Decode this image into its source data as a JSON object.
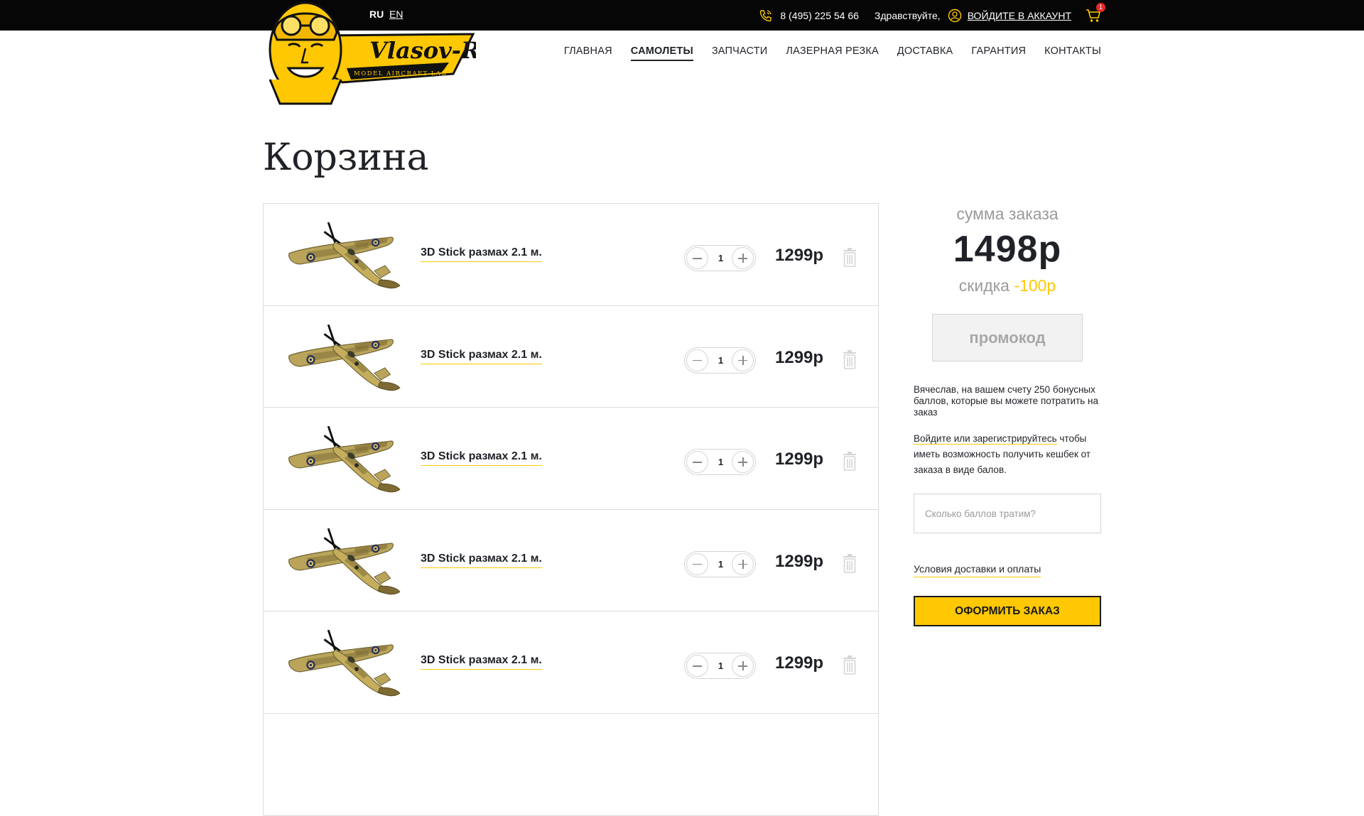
{
  "header": {
    "lang_ru": "RU",
    "lang_en": "EN",
    "phone": "8 (495) 225 54 66",
    "greeting": "Здравствуйте,",
    "login_label": "ВОЙДИТЕ В АККАУНТ",
    "cart_count": "1"
  },
  "logo": {
    "brand": "Vlasov-RC",
    "tagline": "MODEL AIRCRAFT LAB"
  },
  "nav": {
    "items": [
      {
        "label": "ГЛАВНАЯ"
      },
      {
        "label": "САМОЛЕТЫ"
      },
      {
        "label": "ЗАПЧАСТИ"
      },
      {
        "label": "ЛАЗЕРНАЯ РЕЗКА"
      },
      {
        "label": "ДОСТАВКА"
      },
      {
        "label": "ГАРАНТИЯ"
      },
      {
        "label": "КОНТАКТЫ"
      }
    ],
    "active": "САМОЛЕТЫ"
  },
  "page": {
    "title": "Корзина"
  },
  "cart": {
    "items": [
      {
        "name": "3D Stick размах 2.1 м.",
        "qty": "1",
        "price": "1299р"
      },
      {
        "name": "3D Stick размах 2.1 м.",
        "qty": "1",
        "price": "1299р"
      },
      {
        "name": "3D Stick размах 2.1 м.",
        "qty": "1",
        "price": "1299р"
      },
      {
        "name": "3D Stick размах 2.1 м.",
        "qty": "1",
        "price": "1299р"
      },
      {
        "name": "3D Stick размах 2.1 м.",
        "qty": "1",
        "price": "1299р"
      }
    ]
  },
  "summary": {
    "label": "сумма заказа",
    "total": "1498р",
    "discount_label": "скидка",
    "discount_value": "-100р",
    "promo_label": "промокод",
    "bonus_text": "Вячеслав, на вашем счету 250 бонусных баллов, которые вы можете потратить на заказ",
    "login_link": "Войдите или зарегистрируйтесь",
    "login_rest": "чтобы иметь возможность получить кешбек от заказа в виде балов.",
    "points_placeholder": "Сколько баллов тратим?",
    "terms_label": "Условия доставки и оплаты",
    "checkout_label": "ОФОРМИТЬ ЗАКАЗ"
  },
  "colors": {
    "accent": "#ffc803",
    "topbar": "#060606",
    "text": "#1f2227",
    "muted": "#9a9a9a"
  }
}
